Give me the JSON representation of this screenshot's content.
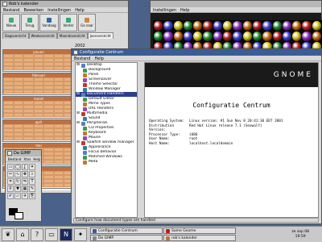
{
  "bg_window": {
    "menu": [
      "Instellingen",
      "Help"
    ]
  },
  "balls_colors": [
    "#b52020",
    "#3e3ed0",
    "#d0c01a",
    "#1e8a2e",
    "#8b2dbd",
    "#c46a12"
  ],
  "calendar": {
    "title": "Rob's kalender",
    "menu": [
      "Bestand",
      "Bewerken",
      "Instellingen",
      "Help"
    ],
    "toolbar": [
      "Nieuw",
      "Terug",
      "Vandaag",
      "Verder",
      "Ga naar",
      "Vorige"
    ],
    "tabs": [
      "Dagoverzicht",
      "Weekoverzicht",
      "Maandoverzicht",
      "Jaaroverzicht"
    ],
    "year": "2002",
    "months": [
      "januari",
      "februari",
      "maart",
      "april",
      "mei",
      "juni"
    ]
  },
  "control_center": {
    "title": "Configuratie Centrum",
    "menu": [
      "Bestand",
      "Help"
    ],
    "tree": [
      {
        "label": "Desktop",
        "level": 0,
        "icon": "desktop-icon"
      },
      {
        "label": "Background",
        "level": 1,
        "icon": "background-icon"
      },
      {
        "label": "Panel",
        "level": 1,
        "icon": "panel-icon"
      },
      {
        "label": "Screensaver",
        "level": 1,
        "icon": "screensaver-icon"
      },
      {
        "label": "Theme Selector",
        "level": 1,
        "icon": "theme-icon"
      },
      {
        "label": "Window Manager",
        "level": 1,
        "icon": "wm-icon"
      },
      {
        "label": "Document Handlers",
        "level": 0,
        "icon": "doc-icon",
        "selected": true
      },
      {
        "label": "Default Editor",
        "level": 1,
        "icon": "editor-icon"
      },
      {
        "label": "Mime Types",
        "level": 1,
        "icon": "mime-icon"
      },
      {
        "label": "URL Handlers",
        "level": 1,
        "icon": "url-icon"
      },
      {
        "label": "Multimedia",
        "level": 0,
        "icon": "multimedia-icon"
      },
      {
        "label": "Sound",
        "level": 1,
        "icon": "sound-icon"
      },
      {
        "label": "Peripherals",
        "level": 0,
        "icon": "peripherals-icon"
      },
      {
        "label": "CD Properties",
        "level": 1,
        "icon": "cd-icon"
      },
      {
        "label": "Keyboard",
        "level": 1,
        "icon": "keyboard-icon"
      },
      {
        "label": "Mouse",
        "level": 1,
        "icon": "mouse-icon"
      },
      {
        "label": "Sawfish window manager",
        "level": 0,
        "icon": "sawfish-icon"
      },
      {
        "label": "Appearance",
        "level": 1,
        "icon": "appearance-icon"
      },
      {
        "label": "Focus behavior",
        "level": 1,
        "icon": "focus-icon"
      },
      {
        "label": "Matched Windows",
        "level": 1,
        "icon": "matched-icon"
      },
      {
        "label": "Meta",
        "level": 1,
        "icon": "meta-icon"
      }
    ],
    "banner": "GNOME",
    "heading": "Configuratie Centrum",
    "info": [
      {
        "k": "Operating System:",
        "v": "Linux  version: #1 Sun Nov 8 20:41:30 EDT 2001"
      },
      {
        "k": "Distribution Version:",
        "v": "Red Hat Linux release 7.1 (Seawolf)"
      },
      {
        "k": "Processor Type:",
        "v": "i686"
      },
      {
        "k": "User Name:",
        "v": "root"
      },
      {
        "k": "Host Name:",
        "v": "localhost.localdomain"
      }
    ],
    "status": "Configure how document types are handled"
  },
  "gimp": {
    "title": "De GIMP",
    "menu": [
      "Bestand",
      "Xtns",
      "Help"
    ]
  },
  "panel": {
    "tasks": [
      "Configuratie Centrum",
      "Same Gnome",
      "De GIMP",
      "rob's kalender"
    ],
    "date": "ze sep 08",
    "time": "19:59",
    "n_label": "N"
  }
}
